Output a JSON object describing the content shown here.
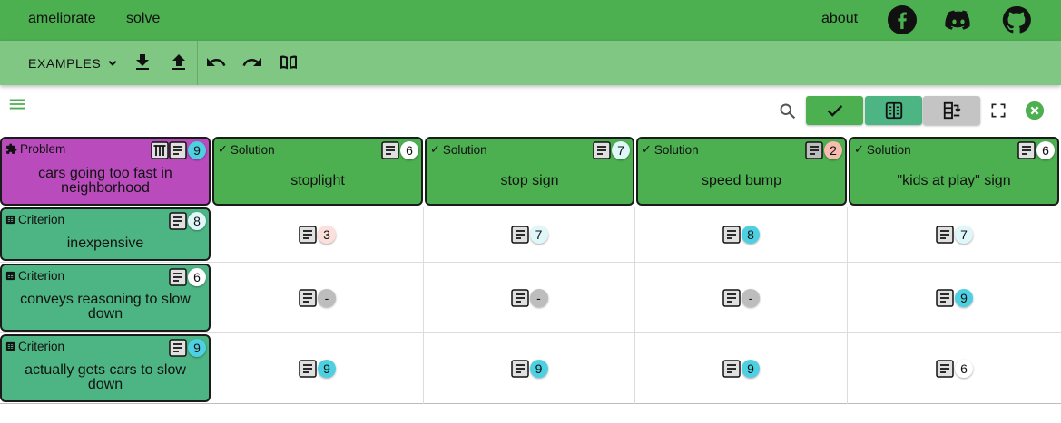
{
  "topbar": {
    "nav": [
      "ameliorate",
      "solve"
    ],
    "about": "about",
    "social": [
      "facebook-icon",
      "discord-icon",
      "github-icon"
    ]
  },
  "toolbar": {
    "examples_label": "EXAMPLES",
    "buttons": [
      "download-icon",
      "upload-icon",
      "undo-icon",
      "redo-icon",
      "book-icon"
    ]
  },
  "controls": {
    "view_buttons": [
      "check-icon",
      "criteria-table-icon",
      "swap-icon"
    ]
  },
  "problem": {
    "type_label": "Problem",
    "text": "cars going too fast in neighborhood",
    "score": "9"
  },
  "solutions": [
    {
      "type_label": "Solution",
      "text": "stoplight",
      "score": "6"
    },
    {
      "type_label": "Solution",
      "text": "stop sign",
      "score": "7"
    },
    {
      "type_label": "Solution",
      "text": "speed bump",
      "score": "2"
    },
    {
      "type_label": "Solution",
      "text": "\"kids at play\" sign",
      "score": "6"
    }
  ],
  "criteria": [
    {
      "type_label": "Criterion",
      "text": "inexpensive",
      "score": "8"
    },
    {
      "type_label": "Criterion",
      "text": "conveys reasoning to slow down",
      "score": "6"
    },
    {
      "type_label": "Criterion",
      "text": "actually gets cars to slow down",
      "score": "9"
    }
  ],
  "matrix": [
    [
      "3",
      "7",
      "8",
      "7"
    ],
    [
      "-",
      "-",
      "-",
      "9"
    ],
    [
      "9",
      "9",
      "9",
      "6"
    ]
  ],
  "colors": {
    "topbar": "#4caf50",
    "toolbar": "#81c784",
    "problem": "#ba4bbd",
    "solution": "#4caf50",
    "criterion": "#4db584"
  }
}
